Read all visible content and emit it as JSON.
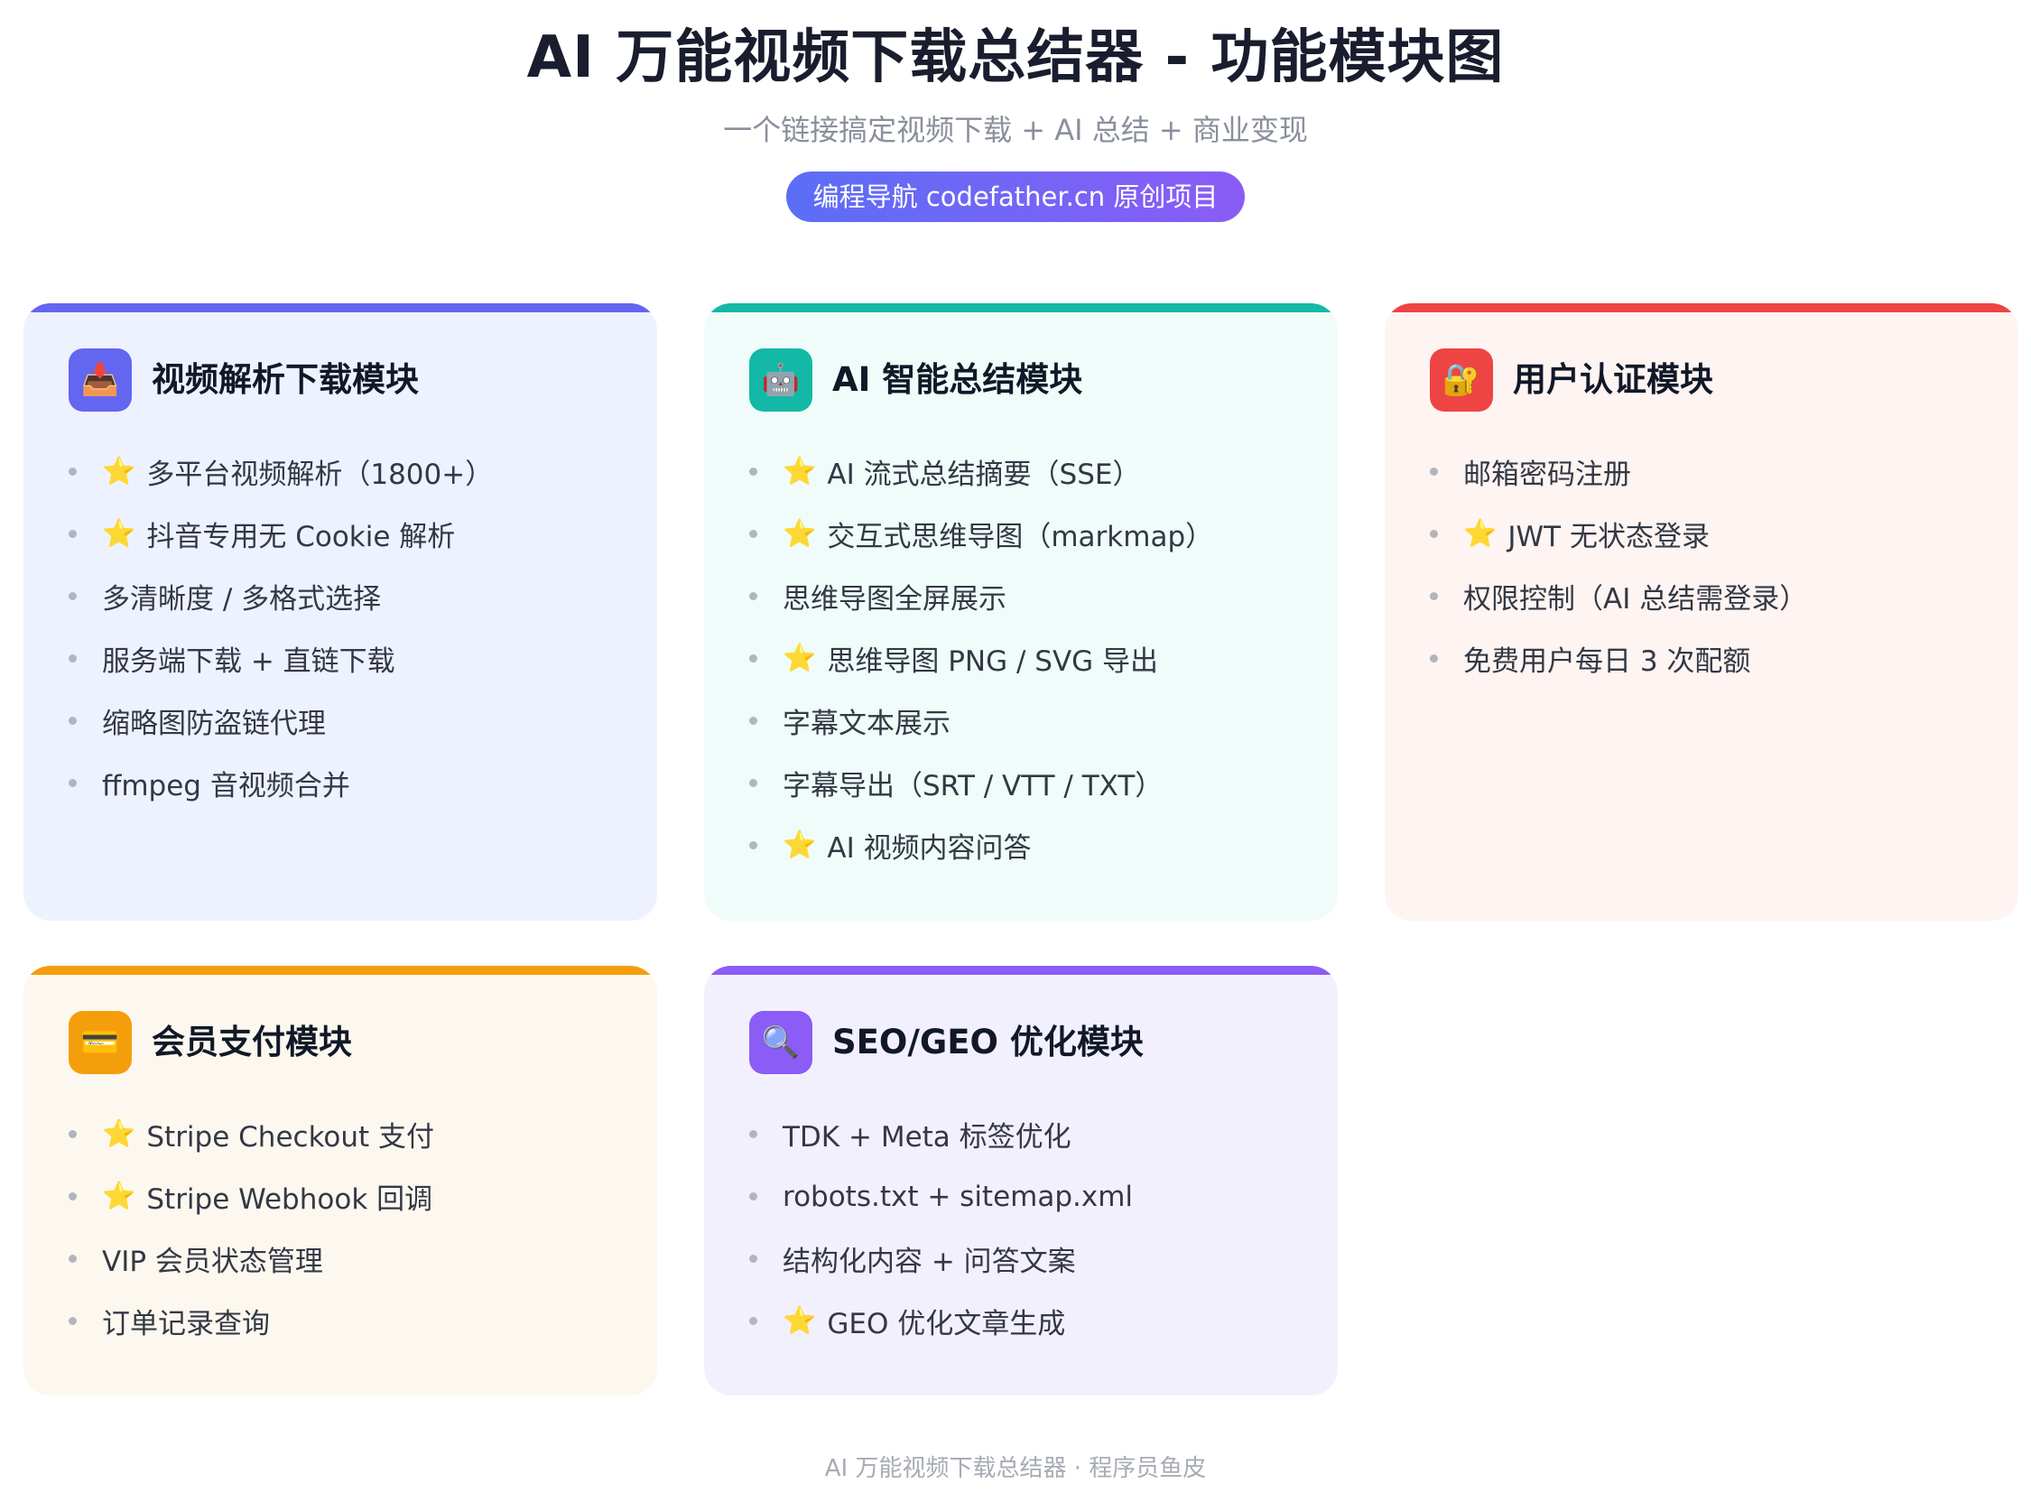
{
  "header": {
    "title": "AI 万能视频下载总结器 - 功能模块图",
    "subtitle": "一个链接搞定视频下载 + AI 总结 + 商业变现",
    "badge": "编程导航 codefather.cn 原创项目"
  },
  "modules": [
    {
      "title": "视频解析下载模块",
      "icon": "inbox-tray-icon",
      "accent": "#6366f1",
      "background": "#eef2fe",
      "items": [
        {
          "text": "多平台视频解析（1800+）",
          "starred": true
        },
        {
          "text": "抖音专用无 Cookie 解析",
          "starred": true
        },
        {
          "text": "多清晰度 / 多格式选择",
          "starred": false
        },
        {
          "text": "服务端下载 + 直链下载",
          "starred": false
        },
        {
          "text": "缩略图防盗链代理",
          "starred": false
        },
        {
          "text": "ffmpeg 音视频合并",
          "starred": false
        }
      ]
    },
    {
      "title": "AI 智能总结模块",
      "icon": "robot-icon",
      "accent": "#14b8a6",
      "background": "#effcf9",
      "items": [
        {
          "text": "AI 流式总结摘要（SSE）",
          "starred": true
        },
        {
          "text": "交互式思维导图（markmap）",
          "starred": true
        },
        {
          "text": "思维导图全屏展示",
          "starred": false
        },
        {
          "text": "思维导图 PNG / SVG 导出",
          "starred": true
        },
        {
          "text": "字幕文本展示",
          "starred": false
        },
        {
          "text": "字幕导出（SRT / VTT / TXT）",
          "starred": false
        },
        {
          "text": "AI 视频内容问答",
          "starred": true
        }
      ]
    },
    {
      "title": "用户认证模块",
      "icon": "lock-key-icon",
      "accent": "#ef4444",
      "background": "#fef4f2",
      "items": [
        {
          "text": "邮箱密码注册",
          "starred": false
        },
        {
          "text": "JWT 无状态登录",
          "starred": true
        },
        {
          "text": "权限控制（AI 总结需登录）",
          "starred": false
        },
        {
          "text": "免费用户每日 3 次配额",
          "starred": false
        }
      ]
    },
    {
      "title": "会员支付模块",
      "icon": "credit-card-icon",
      "accent": "#f59e0b",
      "background": "#fdf8ef",
      "items": [
        {
          "text": "Stripe Checkout 支付",
          "starred": true
        },
        {
          "text": "Stripe Webhook 回调",
          "starred": true
        },
        {
          "text": "VIP 会员状态管理",
          "starred": false
        },
        {
          "text": "订单记录查询",
          "starred": false
        }
      ]
    },
    {
      "title": "SEO/GEO 优化模块",
      "icon": "magnifier-icon",
      "accent": "#8b5cf6",
      "background": "#f3f0fe",
      "items": [
        {
          "text": "TDK + Meta 标签优化",
          "starred": false
        },
        {
          "text": "robots.txt + sitemap.xml",
          "starred": false
        },
        {
          "text": "结构化内容 + 问答文案",
          "starred": false
        },
        {
          "text": "GEO 优化文章生成",
          "starred": true
        }
      ]
    }
  ],
  "footer": "AI 万能视频下载总结器 · 程序员鱼皮"
}
